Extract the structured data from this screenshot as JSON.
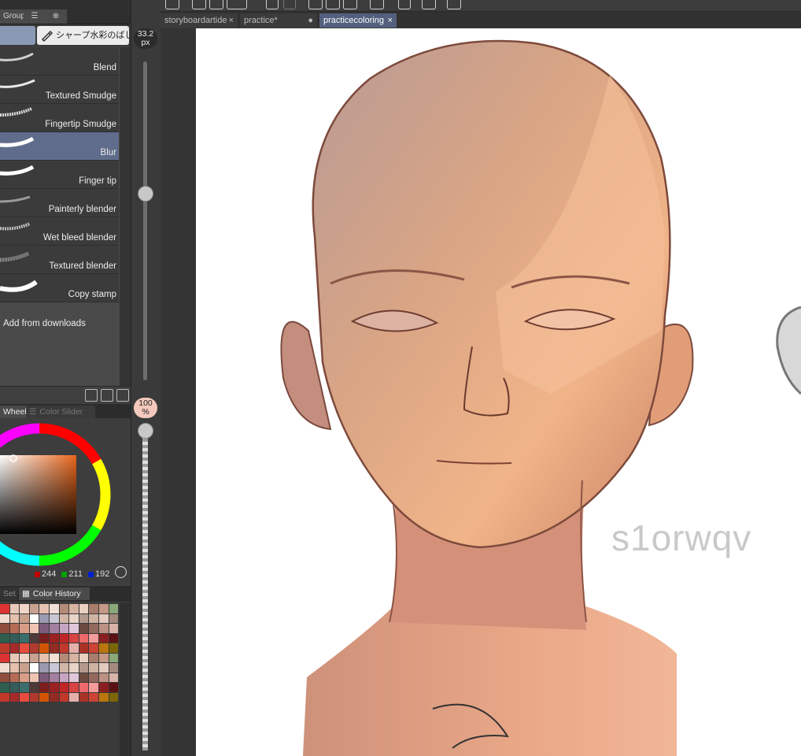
{
  "panel_tabs": {
    "group_label": "Group"
  },
  "subtool": {
    "brush_name": "シャープ水彩のばし"
  },
  "brushes": [
    {
      "name": "Blend",
      "selected": false
    },
    {
      "name": "Textured Smudge",
      "selected": false
    },
    {
      "name": "Fingertip Smudge",
      "selected": false
    },
    {
      "name": "Blur",
      "selected": true
    },
    {
      "name": "Finger tip",
      "selected": false
    },
    {
      "name": "Painterly blender",
      "selected": false
    },
    {
      "name": "Wet bleed blender",
      "selected": false
    },
    {
      "name": "Textured blender",
      "selected": false
    },
    {
      "name": "Copy stamp",
      "selected": false
    }
  ],
  "add_from_downloads": "Add from downloads",
  "brush_size": {
    "value": "33.2",
    "unit": "px"
  },
  "opacity": {
    "value": "100",
    "unit": "%"
  },
  "color_tabs": {
    "wheel": "Wheel",
    "slider": "Color Slider"
  },
  "color": {
    "r": "244",
    "g": "211",
    "b": "192",
    "hex": "#f4d3c0"
  },
  "history_tabs": {
    "set": "Set",
    "history": "Color History"
  },
  "doc_tabs": [
    {
      "label": "storyboardartide",
      "active": false,
      "close": "×"
    },
    {
      "label": "practice*",
      "active": false,
      "close": "●"
    },
    {
      "label": "practicecoloring",
      "active": true,
      "close": "×"
    }
  ],
  "canvas": {
    "watermark": "s1orwqv"
  },
  "accent_color": "#52607d",
  "selection_color": "#5f6c8b"
}
